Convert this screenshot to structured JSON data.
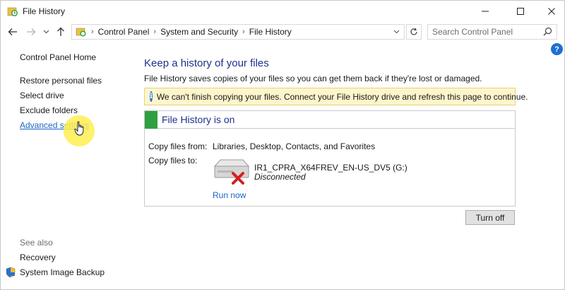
{
  "window": {
    "title": "File History",
    "minimize_glyph": "—",
    "maximize_glyph": "☐",
    "close_glyph": "✕"
  },
  "address_bar": {
    "breadcrumbs": [
      "Control Panel",
      "System and Security",
      "File History"
    ],
    "separator": "›"
  },
  "search": {
    "placeholder": "Search Control Panel"
  },
  "help": {
    "label": "?"
  },
  "sidebar": {
    "home": "Control Panel Home",
    "items": [
      "Restore personal files",
      "Select drive",
      "Exclude folders",
      "Advanced settings"
    ],
    "see_also_label": "See also",
    "see_also": [
      "Recovery",
      "System Image Backup"
    ]
  },
  "main": {
    "title": "Keep a history of your files",
    "description": "File History saves copies of your files so you can get them back if they're lost or damaged.",
    "warning": {
      "icon": "info-icon",
      "glyph": "i",
      "text": "We can't finish copying your files. Connect your File History drive and refresh this page to continue."
    },
    "status_panel": {
      "title": "File History is on",
      "status_color": "#2ea041",
      "copy_from_label": "Copy files from:",
      "copy_from_value": "Libraries, Desktop, Contacts, and Favorites",
      "copy_to_label": "Copy files to:",
      "drive_name": "IR1_CPRA_X64FREV_EN-US_DV5 (G:)",
      "drive_status": "Disconnected",
      "run_now": "Run now"
    },
    "turn_off_button": "Turn off"
  },
  "colors": {
    "link": "#1a66c8",
    "heading": "#1e3287",
    "warning_bg": "#fdf5cc",
    "accent_blue": "#1e6fd0"
  }
}
